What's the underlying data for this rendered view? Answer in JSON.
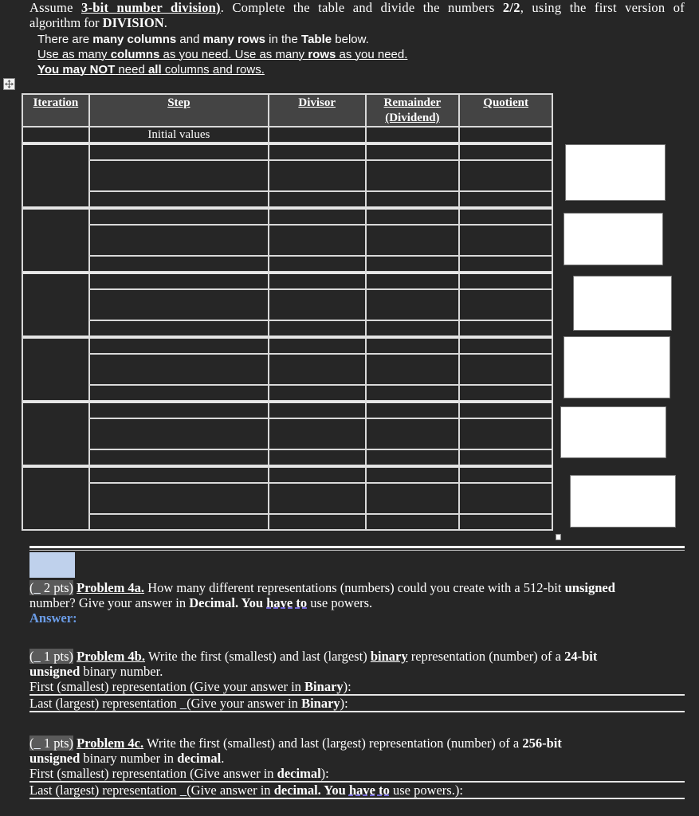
{
  "intro": {
    "assume": "Assume ",
    "bits": "3-bit number division)",
    "complete": ". Complete the table and divide the numbers ",
    "numbers": "2/2",
    "using": ", using the first version of",
    "algorithm": "algorithm for ",
    "division": "DIVISION",
    "period": "."
  },
  "notes": {
    "line1_a": "There are ",
    "line1_b": "many columns",
    "line1_c": " and ",
    "line1_d": "many rows",
    "line1_e": " in the ",
    "line1_f": "Table",
    "line1_g": " below.",
    "line2_a": "Use as many ",
    "line2_b": "columns",
    "line2_c": " as you need. Use as many ",
    "line2_d": "rows",
    "line2_e": " as you need.",
    "line3_a": "You may NOT",
    "line3_b": " need ",
    "line3_c": "all",
    "line3_d": " columns and rows."
  },
  "table": {
    "headers": [
      "Iteration",
      "Step",
      "Divisor",
      "Remainder (Dividend)",
      "Quotient"
    ],
    "header_remainder_1": "Remainder",
    "header_remainder_2": "(Dividend)",
    "initial_row_step": "Initial values",
    "iteration_groups": 6,
    "sub_rows_per_group": 3
  },
  "problems": {
    "p4a": {
      "pts_open": "(",
      "pts_blank": "_",
      "pts_value": " 2 pts)",
      "title": "Problem 4a.",
      "text1": " How many different representations (numbers) could you create with a 512-bit ",
      "unsigned": "unsigned",
      "text2": "number?   Give your answer in ",
      "decimal": "Decimal. You ",
      "have_to": "have to",
      "text3": " use powers.",
      "answer_label": "Answer:"
    },
    "p4b": {
      "pts_open": "(",
      "pts_blank": "_",
      "pts_value": " 1 pts)",
      "title": "Problem 4b.",
      "text1": " Write the first (smallest) and last (largest) ",
      "binary": "binary",
      "text2": " representation (number) of a ",
      "bits": "24-bit",
      "unsigned": "unsigned",
      "text3": " binary number.",
      "first_a": "First (smallest) representation (Give your answer in ",
      "first_b": "Binary",
      "first_c": "):",
      "last_a": "Last (largest) representation ",
      "last_blank": "_",
      "last_b": "(Give your answer in ",
      "last_c": "Binary",
      "last_d": "):"
    },
    "p4c": {
      "pts_open": "(",
      "pts_blank": "_",
      "pts_value": " 1 pts)",
      "title": "Problem 4c.",
      "text1": " Write the first (smallest) and last (largest) representation (number) of a ",
      "bits": "256-bit",
      "unsigned": "unsigned",
      "text2": " binary number in ",
      "decimal": "decimal",
      "text3": ".",
      "first_a": "First (smallest) representation (Give answer in ",
      "first_b": "decimal",
      "first_c": "):",
      "last_a": "Last (largest) representation ",
      "last_blank": "_",
      "last_b": "(Give answer in ",
      "last_c": "decimal. You ",
      "last_d": "have to",
      "last_e": " use powers.):"
    }
  },
  "icons": {
    "table_move_handle": "four-arrows-move-icon",
    "table_resize_handle": "resize-square-icon"
  },
  "colors": {
    "background": "#262626",
    "header_fill": "#444444",
    "answer_label": "#6b9de8",
    "selection": "#bfd1ec",
    "grammar_squiggle": "#7c6ff0"
  }
}
